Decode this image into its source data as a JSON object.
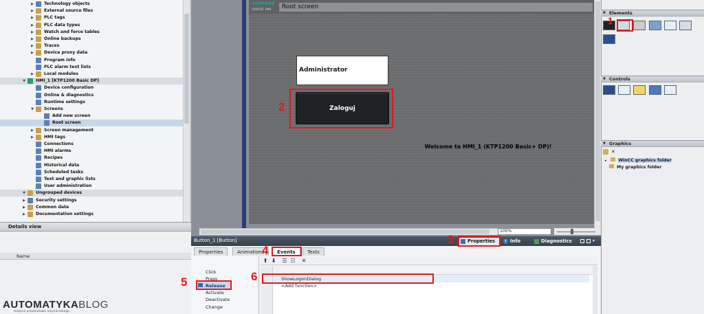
{
  "project_tree": {
    "items": [
      {
        "label": "Technology objects",
        "level": 2,
        "expander": "right",
        "icon_color": "#5b7fb8"
      },
      {
        "label": "External source files",
        "level": 2,
        "expander": "right",
        "icon_color": "#c9a04a"
      },
      {
        "label": "PLC tags",
        "level": 2,
        "expander": "right",
        "icon_color": "#c9a04a"
      },
      {
        "label": "PLC data types",
        "level": 2,
        "expander": "right",
        "icon_color": "#c9a04a"
      },
      {
        "label": "Watch and force tables",
        "level": 2,
        "expander": "right",
        "icon_color": "#c9a04a"
      },
      {
        "label": "Online backups",
        "level": 2,
        "expander": "right",
        "icon_color": "#c9a04a"
      },
      {
        "label": "Traces",
        "level": 2,
        "expander": "right",
        "icon_color": "#c9a04a"
      },
      {
        "label": "Device proxy data",
        "level": 2,
        "expander": "right",
        "icon_color": "#c9a04a"
      },
      {
        "label": "Program info",
        "level": 2,
        "expander": "none",
        "icon_color": "#5b7fb8"
      },
      {
        "label": "PLC alarm text lists",
        "level": 2,
        "expander": "none",
        "icon_color": "#5b7fb8"
      },
      {
        "label": "Local modules",
        "level": 2,
        "expander": "right",
        "icon_color": "#c9a04a"
      },
      {
        "label": "HMI_1 [KTP1200 Basic DP]",
        "level": 1,
        "expander": "down",
        "icon_color": "#2d9b7a",
        "header": true
      },
      {
        "label": "Device configuration",
        "level": 2,
        "expander": "none",
        "icon_color": "#5b7fb8"
      },
      {
        "label": "Online & diagnostics",
        "level": 2,
        "expander": "none",
        "icon_color": "#5b7fb8"
      },
      {
        "label": "Runtime settings",
        "level": 2,
        "expander": "none",
        "icon_color": "#5b7fb8"
      },
      {
        "label": "Screens",
        "level": 2,
        "expander": "down",
        "icon_color": "#c9a04a"
      },
      {
        "label": "Add new screen",
        "level": 3,
        "expander": "none",
        "icon_color": "#5b7fb8"
      },
      {
        "label": "Root screen",
        "level": 3,
        "expander": "none",
        "icon_color": "#5b7fb8",
        "selected": true
      },
      {
        "label": "Screen management",
        "level": 2,
        "expander": "right",
        "icon_color": "#c9a04a"
      },
      {
        "label": "HMI tags",
        "level": 2,
        "expander": "right",
        "icon_color": "#c9a04a"
      },
      {
        "label": "Connections",
        "level": 2,
        "expander": "none",
        "icon_color": "#5b7fb8"
      },
      {
        "label": "HMI alarms",
        "level": 2,
        "expander": "none",
        "icon_color": "#5b7fb8"
      },
      {
        "label": "Recipes",
        "level": 2,
        "expander": "none",
        "icon_color": "#5b7fb8"
      },
      {
        "label": "Historical data",
        "level": 2,
        "expander": "none",
        "icon_color": "#5b7fb8"
      },
      {
        "label": "Scheduled tasks",
        "level": 2,
        "expander": "none",
        "icon_color": "#5b7fb8"
      },
      {
        "label": "Text and graphic lists",
        "level": 2,
        "expander": "none",
        "icon_color": "#5b7fb8"
      },
      {
        "label": "User administration",
        "level": 2,
        "expander": "none",
        "icon_color": "#5b7fb8"
      },
      {
        "label": "Ungrouped devices",
        "level": 1,
        "expander": "down",
        "icon_color": "#c9a04a",
        "header": true
      },
      {
        "label": "Security settings",
        "level": 1,
        "expander": "right",
        "icon_color": "#5b7fb8"
      },
      {
        "label": "Common data",
        "level": 1,
        "expander": "right",
        "icon_color": "#c9a04a"
      },
      {
        "label": "Documentation settings",
        "level": 1,
        "expander": "right",
        "icon_color": "#c9a04a"
      }
    ]
  },
  "details_view": {
    "title": "Details view",
    "column_name": "Name"
  },
  "editor": {
    "brand": "SIEMENS",
    "brand_sub": "SIMATIC HMI",
    "screen_title": "Root screen",
    "admin_field": "Administrator",
    "login_button": "Zaloguj",
    "welcome_text": "Welcome to HMI_1 (KTP1200 Basic+ DP)!",
    "zoom": "100%"
  },
  "inspector": {
    "object_title": "Button_1 [Button]",
    "top_tabs": {
      "properties": "Properties",
      "info": "Info",
      "diagnostics": "Diagnostics"
    },
    "info_icon": "i",
    "sub_tabs": {
      "properties": "Properties",
      "animations": "Animations",
      "events": "Events",
      "texts": "Texts"
    },
    "events": [
      "Click",
      "Press",
      "Release",
      "Activate",
      "Deactivate",
      "Change"
    ],
    "functions": {
      "row1": "ShowLogonDialog",
      "row2": "<Add function>"
    },
    "toolbar_icons": [
      "move-up-icon",
      "move-down-icon",
      "list-icon",
      "list-alt-icon",
      "delete-icon"
    ]
  },
  "right_panes": {
    "elements_title": "Elements",
    "controls_title": "Controls",
    "graphics_title": "Graphics",
    "graphics_items": [
      "WinCC graphics folder",
      "My graphics folder"
    ]
  },
  "annotations": [
    "1",
    "2",
    "3",
    "4",
    "5",
    "6"
  ],
  "watermark": {
    "brand": "AUTOMATYKA",
    "suffix": "BLOG",
    "tagline": "miejsce przykladowe inżynierskiego"
  },
  "colors": {
    "highlight": "#e0191e",
    "selection": "#c6d7e8",
    "hmi_button": "#1f2326"
  }
}
